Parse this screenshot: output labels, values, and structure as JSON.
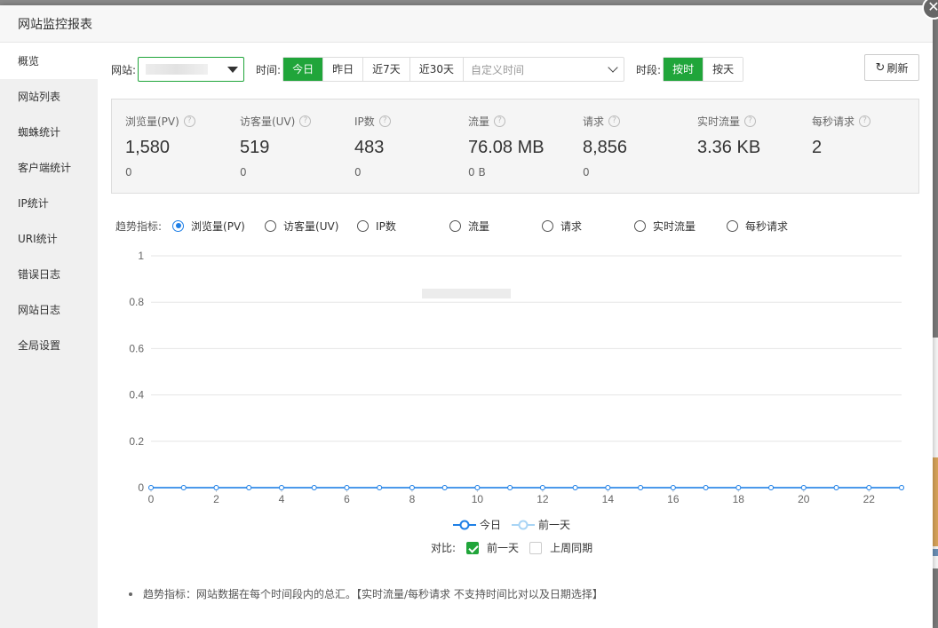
{
  "dialog": {
    "title": "网站监控报表",
    "close_glyph": "✕"
  },
  "sidebar": {
    "items": [
      {
        "label": "概览",
        "active": true
      },
      {
        "label": "网站列表"
      },
      {
        "label": "蜘蛛统计"
      },
      {
        "label": "客户端统计"
      },
      {
        "label": "IP统计"
      },
      {
        "label": "URI统计"
      },
      {
        "label": "错误日志"
      },
      {
        "label": "网站日志"
      },
      {
        "label": "全局设置"
      }
    ]
  },
  "toolbar": {
    "site_label": "网站:",
    "time_label": "时间:",
    "time_buttons": [
      "今日",
      "昨日",
      "近7天",
      "近30天"
    ],
    "custom_time_placeholder": "自定义时间",
    "period_label": "时段:",
    "period_buttons": [
      "按时",
      "按天"
    ],
    "refresh_label": "刷新",
    "refresh_icon": "refresh-icon",
    "accent": "#20a53a"
  },
  "stats": [
    {
      "name": "浏览量(PV)",
      "value": "1,580",
      "sub": "0"
    },
    {
      "name": "访客量(UV)",
      "value": "519",
      "sub": "0"
    },
    {
      "name": "IP数",
      "value": "483",
      "sub": "0"
    },
    {
      "name": "流量",
      "value": "76.08 MB",
      "sub": "0 B"
    },
    {
      "name": "请求",
      "value": "8,856",
      "sub": "0"
    },
    {
      "name": "实时流量",
      "value": "3.36 KB",
      "sub": ""
    },
    {
      "name": "每秒请求",
      "value": "2",
      "sub": ""
    }
  ],
  "trend": {
    "label": "趋势指标:",
    "options": [
      "浏览量(PV)",
      "访客量(UV)",
      "IP数",
      "流量",
      "请求",
      "实时流量",
      "每秒请求"
    ],
    "selected": 0
  },
  "legend": {
    "today": "今日",
    "yesterday": "前一天"
  },
  "compare": {
    "label": "对比:",
    "prev_day": "前一天",
    "prev_day_checked": true,
    "last_week": "上周同期",
    "last_week_checked": false
  },
  "note": "趋势指标：网站数据在每个时间段内的总汇。【实时流量/每秒请求 不支持时间比对以及日期选择】",
  "chart_data": {
    "type": "line",
    "x": [
      0,
      1,
      2,
      3,
      4,
      5,
      6,
      7,
      8,
      9,
      10,
      11,
      12,
      13,
      14,
      15,
      16,
      17,
      18,
      19,
      20,
      21,
      22,
      23
    ],
    "xticks": [
      0,
      2,
      4,
      6,
      8,
      10,
      12,
      14,
      16,
      18,
      20,
      22
    ],
    "yticks": [
      0,
      0.2,
      0.4,
      0.6,
      0.8,
      1
    ],
    "ylim": [
      0,
      1
    ],
    "xlim": [
      0,
      23
    ],
    "series": [
      {
        "name": "今日",
        "color": "#1e7fe6",
        "values": [
          0,
          0,
          0,
          0,
          0,
          0,
          0,
          0,
          0,
          0,
          0,
          0,
          0,
          0,
          0,
          0,
          0,
          0,
          0,
          0,
          0,
          0,
          0,
          0
        ]
      },
      {
        "name": "前一天",
        "color": "#a8d4f5",
        "values": [
          0,
          0,
          0,
          0,
          0,
          0,
          0,
          0,
          0,
          0,
          0,
          0,
          0,
          0,
          0,
          0,
          0,
          0,
          0,
          0,
          0,
          0,
          0,
          0
        ]
      }
    ]
  }
}
